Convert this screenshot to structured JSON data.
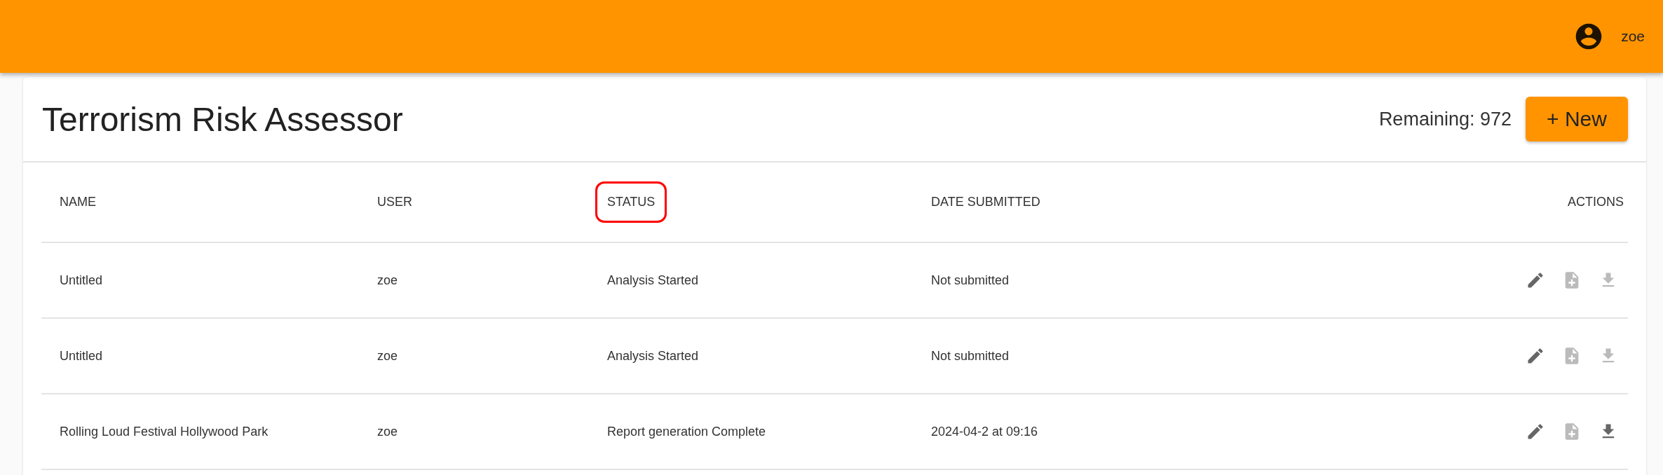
{
  "app_bar": {
    "user": "zoe"
  },
  "page": {
    "title": "Terrorism Risk Assessor",
    "remaining": "Remaining: 972",
    "new_button": "+ New"
  },
  "table": {
    "columns": [
      {
        "label": "NAME",
        "highlighted": false
      },
      {
        "label": "USER",
        "highlighted": false
      },
      {
        "label": "STATUS",
        "highlighted": true
      },
      {
        "label": "DATE SUBMITTED",
        "highlighted": false
      },
      {
        "label": "ACTIONS",
        "highlighted": false
      }
    ],
    "rows": [
      {
        "name": "Untitled",
        "user": "zoe",
        "status": "Analysis Started",
        "date_submitted": "Not submitted",
        "download_enabled": false
      },
      {
        "name": "Untitled",
        "user": "zoe",
        "status": "Analysis Started",
        "date_submitted": "Not submitted",
        "download_enabled": false
      },
      {
        "name": "Rolling Loud Festival Hollywood Park",
        "user": "zoe",
        "status": "Report generation Complete",
        "date_submitted": "2024-04-2 at 09:16",
        "download_enabled": true
      }
    ]
  }
}
